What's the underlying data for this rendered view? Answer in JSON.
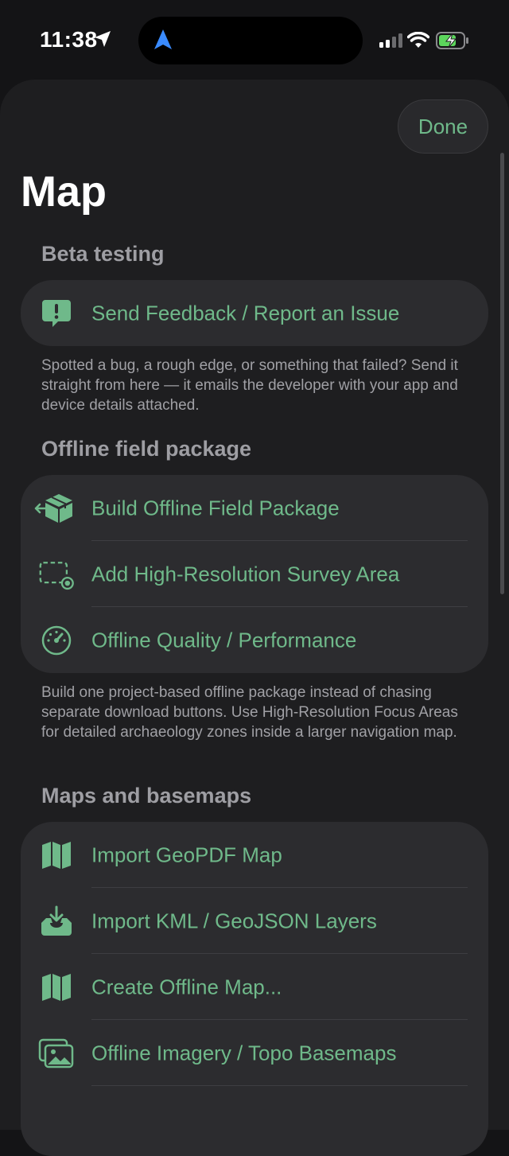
{
  "status_bar": {
    "time": "11:38"
  },
  "sheet": {
    "done_label": "Done",
    "title": "Map",
    "sections": {
      "beta": {
        "header": "Beta testing",
        "items": [
          {
            "label": "Send Feedback / Report an Issue",
            "icon": "feedback-icon"
          }
        ],
        "footer": "Spotted a bug, a rough edge, or something that failed? Send it straight from here — it emails the developer with your app and device details attached."
      },
      "offline": {
        "header": "Offline field package",
        "items": [
          {
            "label": "Build Offline Field Package",
            "icon": "package-icon"
          },
          {
            "label": "Add High-Resolution Survey Area",
            "icon": "survey-area-icon"
          },
          {
            "label": "Offline Quality / Performance",
            "icon": "gauge-icon"
          }
        ],
        "footer": "Build one project-based offline package instead of chasing separate download buttons. Use High-Resolution Focus Areas for detailed archaeology zones inside a larger navigation map."
      },
      "maps": {
        "header": "Maps and basemaps",
        "items": [
          {
            "label": "Import GeoPDF Map",
            "icon": "map-icon"
          },
          {
            "label": "Import KML / GeoJSON Layers",
            "icon": "tray-download-icon"
          },
          {
            "label": "Create Offline Map...",
            "icon": "map-icon"
          },
          {
            "label": "Offline Imagery / Topo Basemaps",
            "icon": "photos-icon"
          }
        ]
      }
    }
  },
  "colors": {
    "accent": "#6fb98a",
    "background": "#141416",
    "sheet": "#1e1e20",
    "card": "#2c2c2f",
    "secondary_text": "#a0a0a5",
    "battery_fill": "#5cd65c",
    "nav_arrow": "#3a8bff"
  }
}
